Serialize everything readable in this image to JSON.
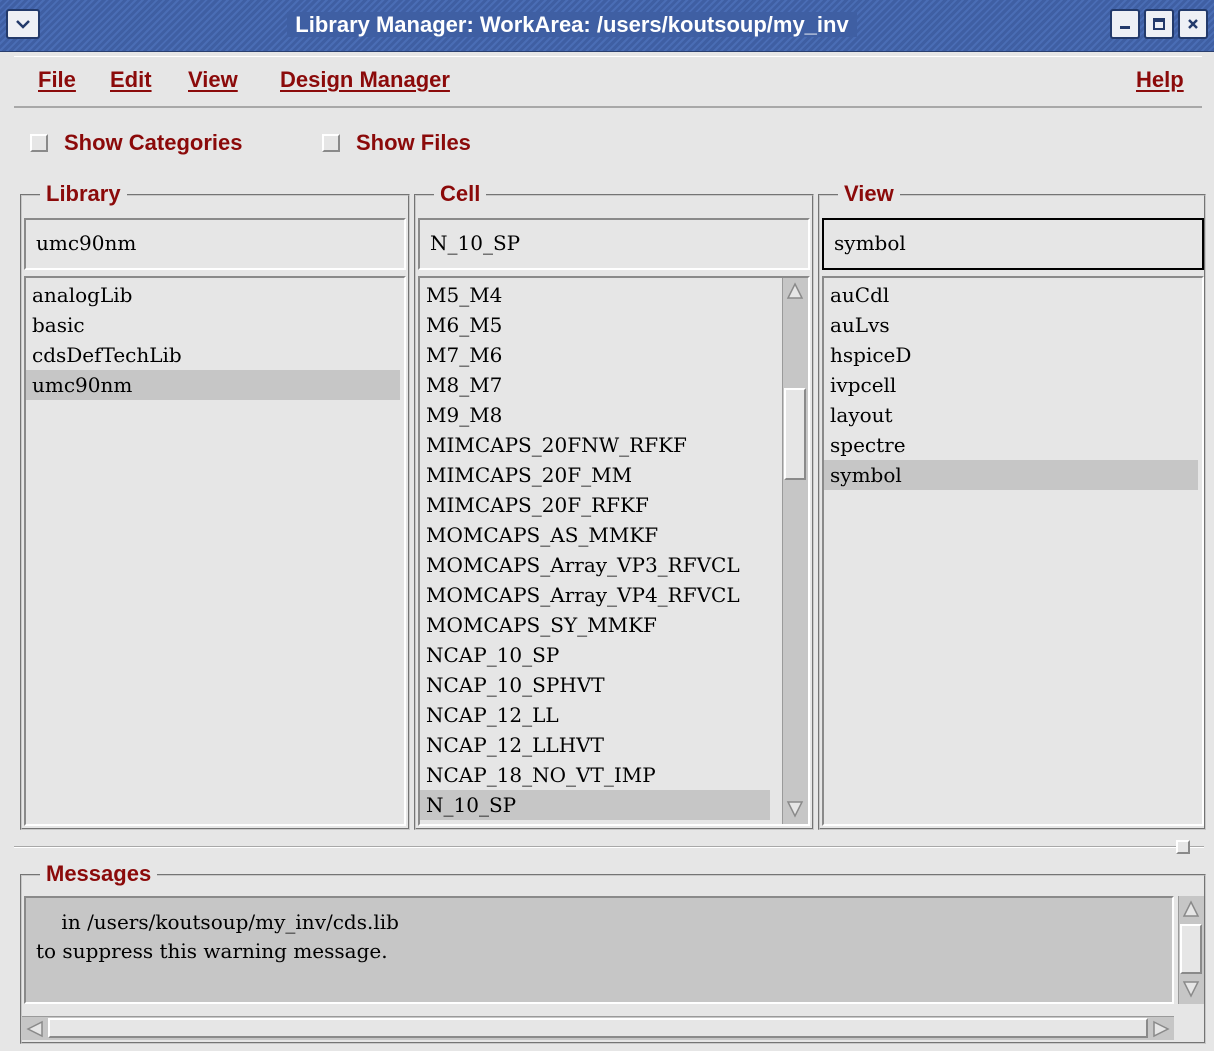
{
  "window": {
    "title": "Library Manager: WorkArea: /users/koutsoup/my_inv"
  },
  "menubar": {
    "items": [
      "File",
      "Edit",
      "View",
      "Design Manager"
    ],
    "help": "Help"
  },
  "options": {
    "show_categories": {
      "label": "Show Categories",
      "checked": false
    },
    "show_files": {
      "label": "Show Files",
      "checked": false
    }
  },
  "library": {
    "title": "Library",
    "value": "umc90nm",
    "items": [
      "analogLib",
      "basic",
      "cdsDefTechLib",
      "umc90nm"
    ],
    "selected": "umc90nm"
  },
  "cell": {
    "title": "Cell",
    "value": "N_10_SP",
    "items": [
      "M5_M4",
      "M6_M5",
      "M7_M6",
      "M8_M7",
      "M9_M8",
      "MIMCAPS_20FNW_RFKF",
      "MIMCAPS_20F_MM",
      "MIMCAPS_20F_RFKF",
      "MOMCAPS_AS_MMKF",
      "MOMCAPS_Array_VP3_RFVCL",
      "MOMCAPS_Array_VP4_RFVCL",
      "MOMCAPS_SY_MMKF",
      "NCAP_10_SP",
      "NCAP_10_SPHVT",
      "NCAP_12_LL",
      "NCAP_12_LLHVT",
      "NCAP_18_NO_VT_IMP",
      "N_10_SP"
    ],
    "selected": "N_10_SP"
  },
  "view": {
    "title": "View",
    "value": "symbol",
    "items": [
      "auCdl",
      "auLvs",
      "hspiceD",
      "ivpcell",
      "layout",
      "spectre",
      "symbol"
    ],
    "selected": "symbol"
  },
  "messages": {
    "title": "Messages",
    "text": "    in /users/koutsoup/my_inv/cds.lib\nto suppress this warning message."
  },
  "colors": {
    "label_red": "#8b0a0a",
    "title_blue": "#3f5fa3",
    "background": "#e6e6e6",
    "selection": "#c6c6c6"
  }
}
